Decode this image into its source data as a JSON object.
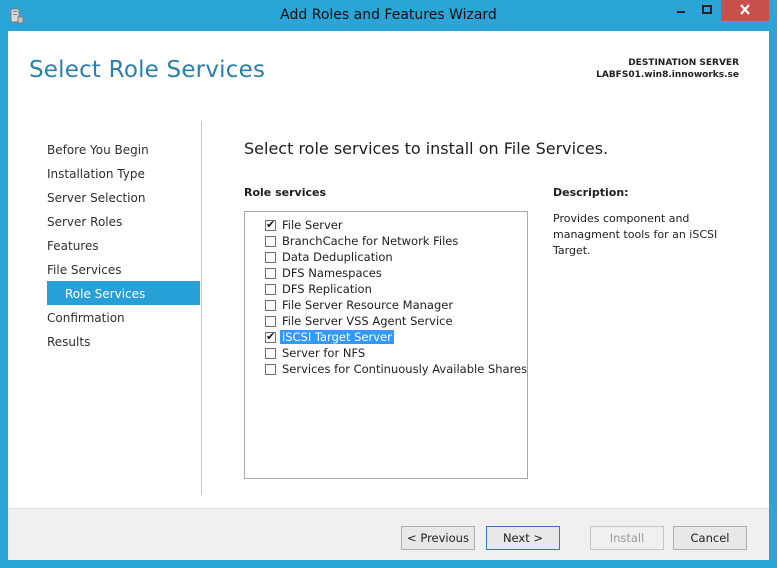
{
  "window": {
    "title": "Add Roles and Features Wizard",
    "controls": {
      "minimize": "minimize-icon",
      "maximize": "maximize-icon",
      "close": "close-icon"
    }
  },
  "header": {
    "page_title": "Select Role Services",
    "destination_label": "DESTINATION SERVER",
    "destination_server": "LABFS01.win8.innoworks.se"
  },
  "nav": {
    "items": [
      {
        "label": "Before You Begin"
      },
      {
        "label": "Installation Type"
      },
      {
        "label": "Server Selection"
      },
      {
        "label": "Server Roles"
      },
      {
        "label": "Features"
      },
      {
        "label": "File Services"
      },
      {
        "label": "Role Services",
        "selected": true
      },
      {
        "label": "Confirmation"
      },
      {
        "label": "Results"
      }
    ]
  },
  "main": {
    "heading": "Select role services to install on File Services.",
    "role_services_label": "Role services",
    "description_label": "Description:",
    "description_text": "Provides component and managment tools for an iSCSI Target.",
    "roles": [
      {
        "label": "File Server",
        "checked": true
      },
      {
        "label": "BranchCache for Network Files",
        "checked": false
      },
      {
        "label": "Data Deduplication",
        "checked": false
      },
      {
        "label": "DFS Namespaces",
        "checked": false
      },
      {
        "label": "DFS Replication",
        "checked": false
      },
      {
        "label": "File Server Resource Manager",
        "checked": false
      },
      {
        "label": "File Server VSS Agent Service",
        "checked": false
      },
      {
        "label": "iSCSI Target Server",
        "checked": true,
        "highlighted": true
      },
      {
        "label": "Server for NFS",
        "checked": false
      },
      {
        "label": "Services for Continuously Available Shares",
        "checked": false
      }
    ],
    "check_mark": "✔"
  },
  "footer": {
    "previous": "< Previous",
    "next": "Next >",
    "install": "Install",
    "cancel": "Cancel"
  },
  "colors": {
    "titlebar": "#2aa5d6",
    "accent_title": "#2a7fae",
    "nav_selected": "#26a0d6",
    "selection_highlight": "#3399ff",
    "close_button": "#c7504a"
  }
}
